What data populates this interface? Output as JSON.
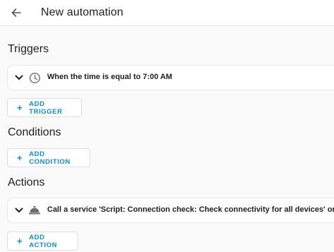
{
  "header": {
    "title": "New automation",
    "back_icon": "arrow-left-icon"
  },
  "triggers": {
    "title": "Triggers",
    "items": [
      {
        "label": "When the time is equal to 7:00 AM",
        "icon": "clock-icon"
      }
    ],
    "add_label": "ADD TRIGGER"
  },
  "conditions": {
    "title": "Conditions",
    "add_label": "ADD CONDITION"
  },
  "actions": {
    "title": "Actions",
    "items": [
      {
        "label": "Call a service 'Script: Connection check: Check connectivity for all devices' on",
        "icon": "service-bell-icon"
      }
    ],
    "add_label": "ADD ACTION"
  },
  "colors": {
    "accent": "#0f8bce",
    "background": "#fafafa",
    "card": "#ffffff"
  }
}
